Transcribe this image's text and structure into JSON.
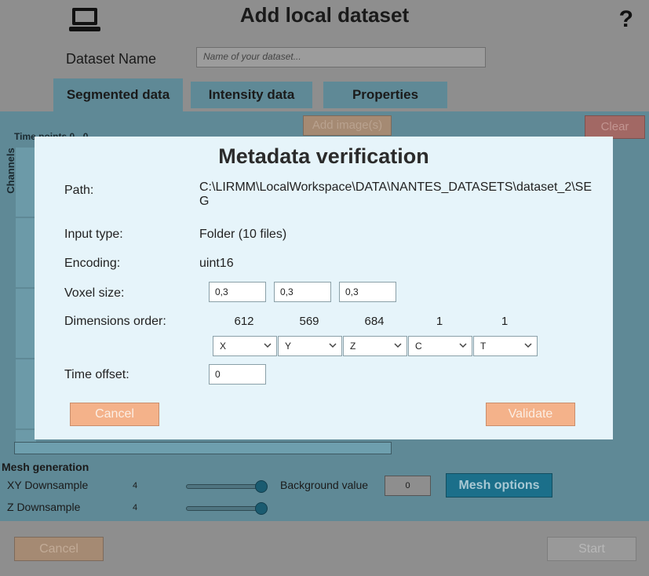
{
  "window": {
    "title": "Add local dataset",
    "help_label": "?",
    "laptop_icon": "laptop-icon"
  },
  "dataset_name": {
    "label": "Dataset Name",
    "placeholder": "Name of your dataset..."
  },
  "tabs": [
    {
      "label": "Segmented data"
    },
    {
      "label": "Intensity data"
    },
    {
      "label": "Properties"
    }
  ],
  "panel": {
    "add_images_label": "Add image(s)",
    "clear_label": "Clear",
    "time_points_label": "Time points   0 - 0",
    "channels_label": "Channels"
  },
  "mesh": {
    "title": "Mesh generation",
    "xy_label": "XY Downsample",
    "xy_value": "4",
    "xy_level": 1.0,
    "z_label": "Z Downsample",
    "z_value": "4",
    "z_level": 1.0,
    "background_label": "Background value",
    "background_value": "0",
    "options_label": "Mesh options"
  },
  "footer": {
    "cancel_label": "Cancel",
    "start_label": "Start"
  },
  "modal": {
    "title": "Metadata verification",
    "path_label": "Path:",
    "path_value": "C:\\LIRMM\\LocalWorkspace\\DATA\\NANTES_DATASETS\\dataset_2\\SEG",
    "input_type_label": "Input type:",
    "input_type_value": "Folder (10 files)",
    "encoding_label": "Encoding:",
    "encoding_value": "uint16",
    "voxel_label": "Voxel size:",
    "voxel_values": [
      "0,3",
      "0,3",
      "0,3"
    ],
    "dims_label": "Dimensions order:",
    "dims": [
      "612",
      "569",
      "684",
      "1",
      "1"
    ],
    "dim_axes": [
      "X",
      "Y",
      "Z",
      "C",
      "T"
    ],
    "time_offset_label": "Time offset:",
    "time_offset_value": "0",
    "cancel_label": "Cancel",
    "validate_label": "Validate"
  },
  "colors": {
    "panel": "#5f8996",
    "modal_bg": "#e6f4fa",
    "button_orange": "#f4b28a",
    "mesh_options": "#1b6f8a"
  }
}
